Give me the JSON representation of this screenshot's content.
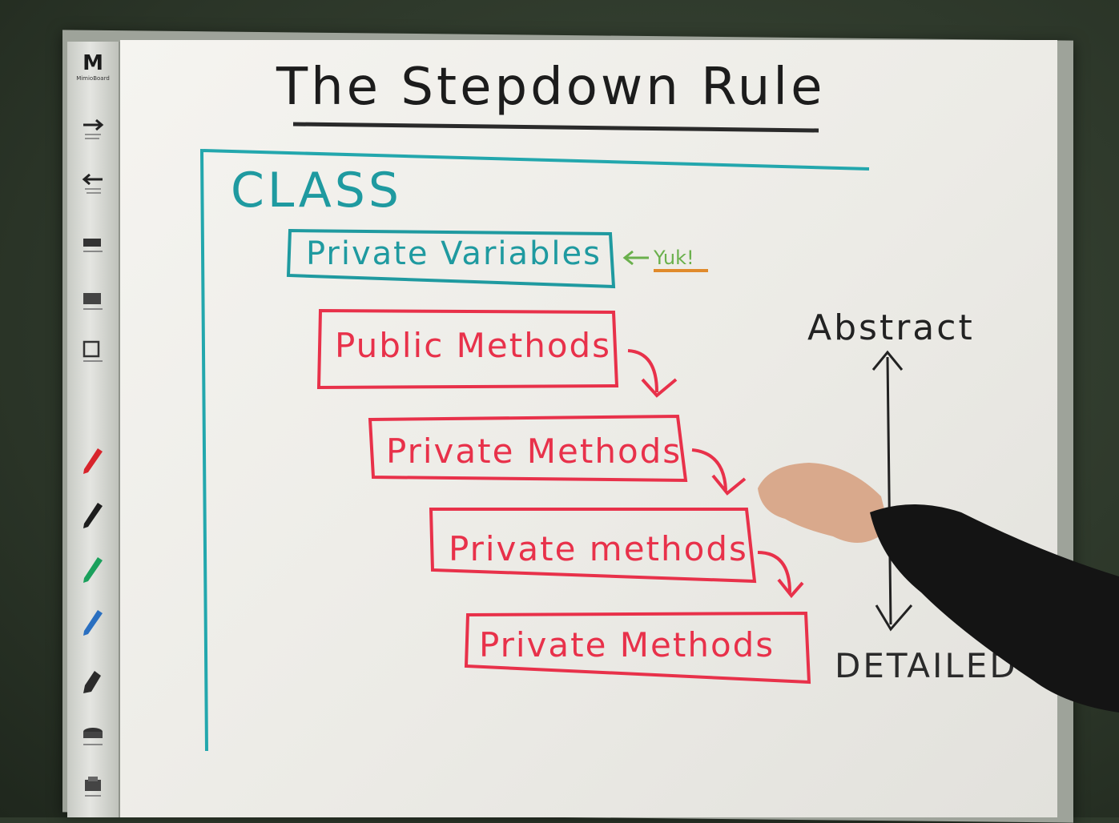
{
  "whiteboard": {
    "title": "The Stepdown Rule",
    "class_label": "CLASS",
    "boxes": [
      {
        "label": "Private Variables",
        "color": "#1f9aa0"
      },
      {
        "label": "Public Methods",
        "color": "#e8314a"
      },
      {
        "label": "Private Methods",
        "color": "#e8314a"
      },
      {
        "label": "Private methods",
        "color": "#e8314a"
      },
      {
        "label": "Private Methods",
        "color": "#e8314a"
      }
    ],
    "annotation": "Yuk!",
    "annotation_color": "#6ab04c",
    "underline_color": "#e08a2c",
    "axis_top": "Abstract",
    "axis_bottom": "DETAILED"
  },
  "tray": {
    "logo_mark": "M",
    "logo_text": "MimioBoard",
    "tools": [
      "forward-arrow-icon",
      "back-arrow-icon",
      "marker-icon",
      "eraser-icon",
      "select-icon",
      "red-pen-icon",
      "black-pen-icon",
      "green-pen-icon",
      "blue-pen-icon",
      "brush-icon",
      "eraser-block-icon",
      "print-icon"
    ]
  }
}
